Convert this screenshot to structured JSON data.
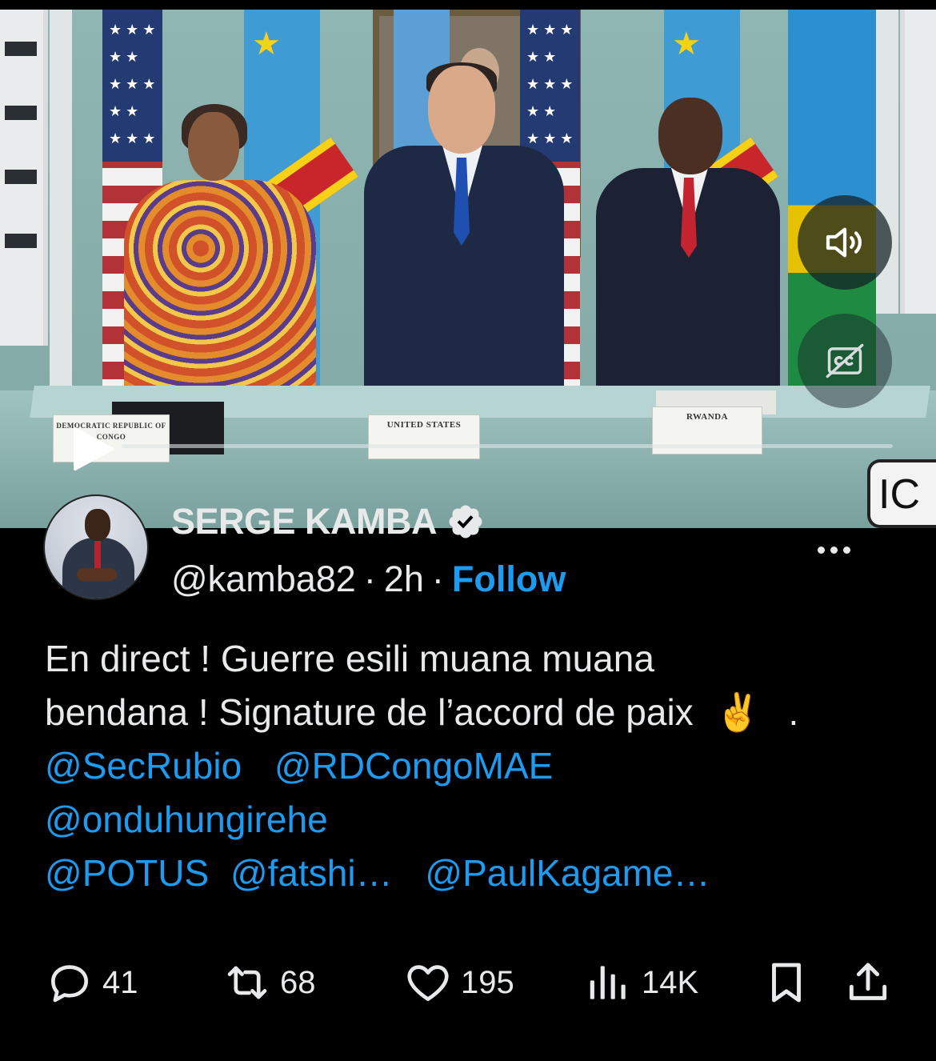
{
  "video": {
    "nameplates": {
      "drc": "DEMOCRATIC REPUBLIC OF CONGO",
      "us": "UNITED STATES",
      "rwanda": "RWANDA"
    },
    "corner_sign": "IC",
    "controls": {
      "play_icon": "play-icon",
      "volume_icon": "speaker-icon",
      "captions_icon": "captions-off-icon"
    }
  },
  "tweet": {
    "author": {
      "display_name": "SERGE KAMBA",
      "handle": "@kamba82",
      "separator": "·",
      "time": "2h",
      "follow_label": "Follow",
      "verified_icon": "verified-badge-icon"
    },
    "text": {
      "line1": "En direct ! Guerre esili muana muana",
      "line2": "bendana ! Signature de l’accord de paix",
      "emoji": "✌️",
      "line2_end": ".",
      "mentions": [
        "@SecRubio",
        "@RDCongoMAE",
        "@onduhungirehe",
        "@POTUS",
        "@fatshi…",
        "@PaulKagame…"
      ]
    },
    "stats": {
      "replies": "41",
      "reposts": "68",
      "likes": "195",
      "views": "14K"
    }
  },
  "colors": {
    "background": "#000000",
    "text": "#e7e9ea",
    "accent_blue": "#1d9bf0"
  }
}
